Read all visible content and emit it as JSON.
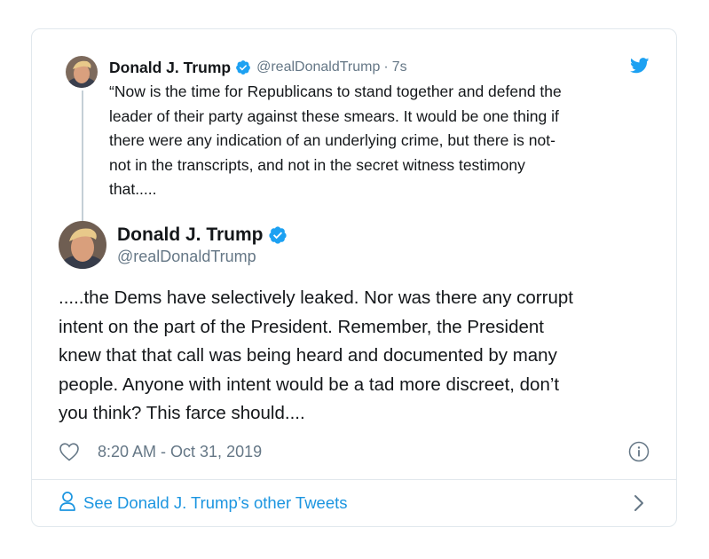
{
  "parent_tweet": {
    "author_name": "Donald J. Trump",
    "handle": "@realDonaldTrump",
    "separator": "·",
    "time": "7s",
    "text_lines": [
      "“Now is the time for Republicans to stand together and defend the",
      "leader of their party against these smears. It would be one thing if",
      "there were any indication of an underlying crime, but there is not-",
      "not in the transcripts, and not in the secret witness testimony",
      "that....."
    ]
  },
  "main_tweet": {
    "author_name": "Donald J. Trump",
    "handle": "@realDonaldTrump",
    "text_lines": [
      ".....the Dems have selectively leaked. Nor was there any corrupt",
      "intent on the part of the President. Remember, the President",
      "knew that that call was being heard and documented by many",
      "people. Anyone with intent would be a tad more discreet, don’t",
      "you think? This farce should...."
    ],
    "timestamp": "8:20 AM - Oct 31, 2019"
  },
  "footer": {
    "link_label": "See Donald J. Trump’s other Tweets"
  },
  "icons": {
    "verified": "verified-badge-icon",
    "brand": "twitter-bird-icon",
    "like": "heart-icon",
    "info": "info-icon",
    "profile": "person-icon",
    "chevron": "chevron-right-icon"
  },
  "colors": {
    "accent": "#1da1f2",
    "link": "#1b95e0",
    "secondary_text": "#657786",
    "primary_text": "#14171a",
    "border": "#e1e8ed"
  }
}
